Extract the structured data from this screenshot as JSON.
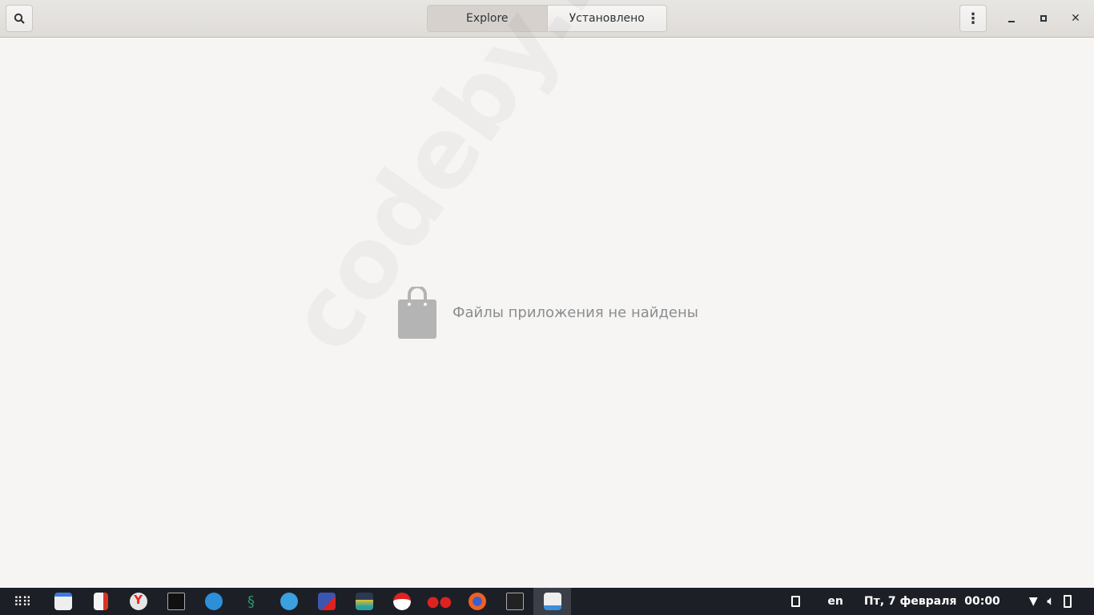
{
  "header": {
    "tabs": [
      {
        "label": "Explore",
        "active": true
      },
      {
        "label": "Установлено",
        "active": false
      }
    ]
  },
  "main": {
    "empty_message": "Файлы приложения не найдены",
    "watermark": "codeby.net"
  },
  "taskbar": {
    "apps": [
      "app-grid",
      "files",
      "text-editor",
      "yandex-browser",
      "terminal",
      "wireshark",
      "kali-dragon",
      "telegram",
      "virtualbox",
      "system-monitor",
      "download-manager",
      "cherrytree",
      "firefox",
      "terminal-2",
      "software-center"
    ],
    "tray": {
      "lang": "en",
      "datetime": "Пт, 7 февраля  00:00"
    }
  }
}
